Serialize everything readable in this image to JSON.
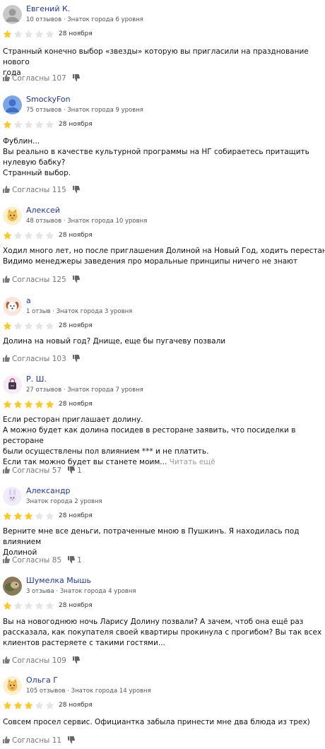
{
  "labels": {
    "agree": "Согласны",
    "read_more": "Читать ещё"
  },
  "colors": {
    "star_on": "#fcca1f",
    "star_off": "#e4e4e4",
    "link": "#1f35a8"
  },
  "reviews": [
    {
      "name": "Евгений К.",
      "meta": "10 отзывов · Знаток города 6 уровня",
      "rating": 1,
      "date": "28 ноября",
      "avatar": "default-gray",
      "text": "Странный конечно выбор «звезды» которую вы пригласили на празднование нового\nгода",
      "more": "",
      "agree_count": "107",
      "disagree_count": ""
    },
    {
      "name": "SmockyFon",
      "meta": "75 отзывов · Знаток города 9 уровня",
      "rating": 1,
      "date": "28 ноября",
      "avatar": "default-blue",
      "text": "Фублин...\nВы реально в качестве культурной программы на НГ собираетесь притащить\nнулевую бабку?\nСтранный выбор.",
      "more": "",
      "agree_count": "115",
      "disagree_count": ""
    },
    {
      "name": "Алексей",
      "meta": "48 отзывов · Знаток города 10 уровня",
      "rating": 1,
      "date": "28 ноября",
      "avatar": "cat",
      "text": "Ходил много лет, но после приглашения Долиной на Новый Год, ходить перестану.\nВидимо менеджеры заведения про моральные принципы ничего не знают",
      "more": "",
      "agree_count": "125",
      "disagree_count": ""
    },
    {
      "name": "а",
      "meta": "1 отзыв · Знаток города 3 уровня",
      "rating": 1,
      "date": "28 ноября",
      "avatar": "dog",
      "text": "Долина на новый год? Днище, еще бы пугачеву позвали",
      "more": "",
      "agree_count": "103",
      "disagree_count": ""
    },
    {
      "name": "Р. Ш.",
      "meta": "27 отзывов · Знаток города 7 уровня",
      "rating": 5,
      "date": "28 ноября",
      "avatar": "bag",
      "text": "Если ресторан приглашает долину.\nА можно будет как долина посидев в ресторане заявить, что посиделки в ресторане\nбыли осуществлены пол влиянием *** и не платить.\nЕсли так можно будет вы станете моим... ",
      "more": "Читать ещё",
      "agree_count": "57",
      "disagree_count": "1"
    },
    {
      "name": "Александр",
      "meta": "Знаток города 2 уровня",
      "rating": 3,
      "date": "28 ноября",
      "avatar": "rabbit",
      "text": "Верните мне все деньги, потраченные мною в Пушкинъ. Я находилась под влиянием\nДолиной",
      "more": "",
      "agree_count": "85",
      "disagree_count": "1"
    },
    {
      "name": "Шумелка Мышь",
      "meta": "3 отзыва · Знаток города 4 уровня",
      "rating": 1,
      "date": "28 ноября",
      "avatar": "photo",
      "text": "Вы на новогоднюю ночь Ларису Долину позвали? А зачем, чтоб она ещё раз\nрассказала, как покупателя своей квартиры прокинула с прогибом? Вы так всех\nклиентов растеряете с такими гостями...",
      "more": "",
      "agree_count": "109",
      "disagree_count": ""
    },
    {
      "name": "Ольга Г",
      "meta": "105 отзывов · Знаток города 14 уровня",
      "rating": 3,
      "date": "28 ноября",
      "avatar": "cat",
      "text": "Совсем просел сервис. Официантка забыла принести мне два блюда из трех)",
      "more": "",
      "agree_count": "11",
      "disagree_count": ""
    }
  ]
}
